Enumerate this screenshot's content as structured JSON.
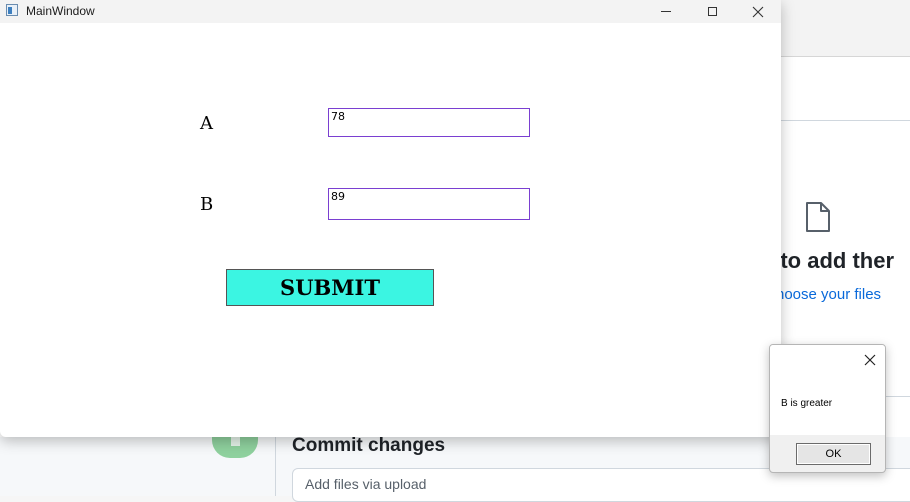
{
  "background": {
    "drag_text": "e to add ther",
    "choose_files_link": "hoose your files",
    "commit_title": "Commit changes",
    "commit_placeholder": "Add files via upload"
  },
  "window": {
    "title": "MainWindow",
    "label_a": "A",
    "label_b": "B",
    "value_a": "78",
    "value_b": "89",
    "submit_label": "SUBMIT"
  },
  "dialog": {
    "message": "B is greater",
    "ok_label": "OK"
  },
  "colors": {
    "submit_bg": "#3bf5e2",
    "field_border": "#7a3fd1",
    "link": "#0969da"
  }
}
